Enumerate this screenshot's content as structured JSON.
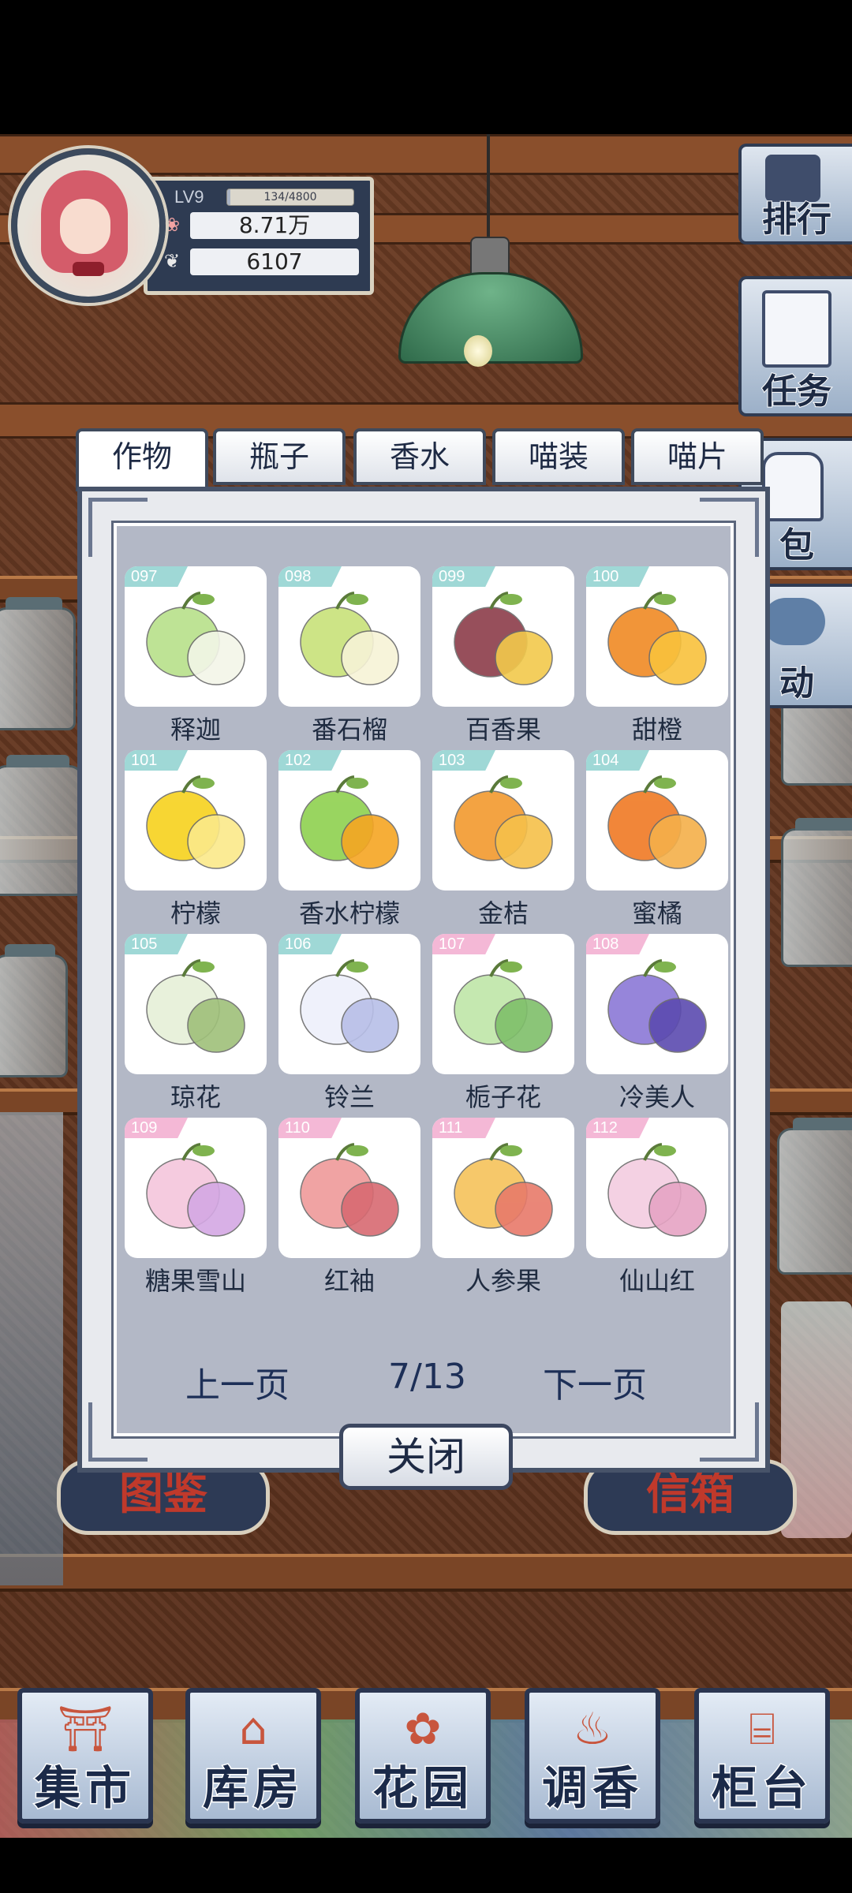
{
  "profile": {
    "level": "LV9",
    "xp_text": "134/4800",
    "xp_fraction": 0.028,
    "petals": "8.71万",
    "leaves": "6107"
  },
  "side_buttons": [
    {
      "label": "排行",
      "icon": "ranking-icon"
    },
    {
      "label": "任务",
      "icon": "clipboard-icon"
    },
    {
      "label": "包",
      "icon": "bag-icon"
    },
    {
      "label": "动",
      "icon": "activity-icon"
    }
  ],
  "tabs": [
    {
      "label": "作物",
      "active": true
    },
    {
      "label": "瓶子",
      "active": false
    },
    {
      "label": "香水",
      "active": false
    },
    {
      "label": "喵装",
      "active": false
    },
    {
      "label": "喵片",
      "active": false
    }
  ],
  "items": [
    {
      "num": "097",
      "name": "释迦",
      "tag": "teal",
      "colors": [
        "#b7e08a",
        "#f3f6e8"
      ]
    },
    {
      "num": "098",
      "name": "番石榴",
      "tag": "teal",
      "colors": [
        "#c8e27a",
        "#f7f3d6"
      ]
    },
    {
      "num": "099",
      "name": "百香果",
      "tag": "teal",
      "colors": [
        "#8c3d4a",
        "#f2c94c"
      ]
    },
    {
      "num": "100",
      "name": "甜橙",
      "tag": "teal",
      "colors": [
        "#f08a24",
        "#f9c23c"
      ]
    },
    {
      "num": "101",
      "name": "柠檬",
      "tag": "teal",
      "colors": [
        "#f7d21e",
        "#fbe98a"
      ]
    },
    {
      "num": "102",
      "name": "香水柠檬",
      "tag": "teal",
      "colors": [
        "#8fd14f",
        "#f6a623"
      ]
    },
    {
      "num": "103",
      "name": "金桔",
      "tag": "teal",
      "colors": [
        "#f29a2e",
        "#f6c04a"
      ]
    },
    {
      "num": "104",
      "name": "蜜橘",
      "tag": "teal",
      "colors": [
        "#f07a24",
        "#f5b04a"
      ]
    },
    {
      "num": "105",
      "name": "琼花",
      "tag": "teal",
      "colors": [
        "#e6f0d8",
        "#9fc07a"
      ]
    },
    {
      "num": "106",
      "name": "铃兰",
      "tag": "teal",
      "colors": [
        "#eef0fb",
        "#b8bfe8"
      ]
    },
    {
      "num": "107",
      "name": "栀子花",
      "tag": "pink",
      "colors": [
        "#bfe6a8",
        "#7fbf6a"
      ]
    },
    {
      "num": "108",
      "name": "冷美人",
      "tag": "pink",
      "colors": [
        "#8b78d6",
        "#5c4bb0"
      ]
    },
    {
      "num": "109",
      "name": "糖果雪山",
      "tag": "pink",
      "colors": [
        "#f4c6dc",
        "#d4a8e4"
      ]
    },
    {
      "num": "110",
      "name": "红袖",
      "tag": "pink",
      "colors": [
        "#ef9a9a",
        "#d86a72"
      ]
    },
    {
      "num": "111",
      "name": "人参果",
      "tag": "pink",
      "colors": [
        "#f6c35a",
        "#e87a6a"
      ]
    },
    {
      "num": "112",
      "name": "仙山红",
      "tag": "pink",
      "colors": [
        "#f3cde0",
        "#e6a4c4"
      ]
    }
  ],
  "pager": {
    "prev": "上一页",
    "page": "7/13",
    "next": "下一页"
  },
  "close_label": "关闭",
  "bottom_nav": [
    {
      "label": "集市",
      "icon": "market-gate-icon"
    },
    {
      "label": "库房",
      "icon": "warehouse-icon"
    },
    {
      "label": "花园",
      "icon": "rose-icon"
    },
    {
      "label": "调香",
      "icon": "perfume-bottle-icon"
    },
    {
      "label": "柜台",
      "icon": "counter-icon"
    }
  ],
  "behind_signs": [
    "图鉴",
    "信箱"
  ],
  "colors": {
    "tag_teal": "#9fd8d6",
    "tag_pink": "#f4b8d6",
    "ink": "#1e2a44"
  }
}
